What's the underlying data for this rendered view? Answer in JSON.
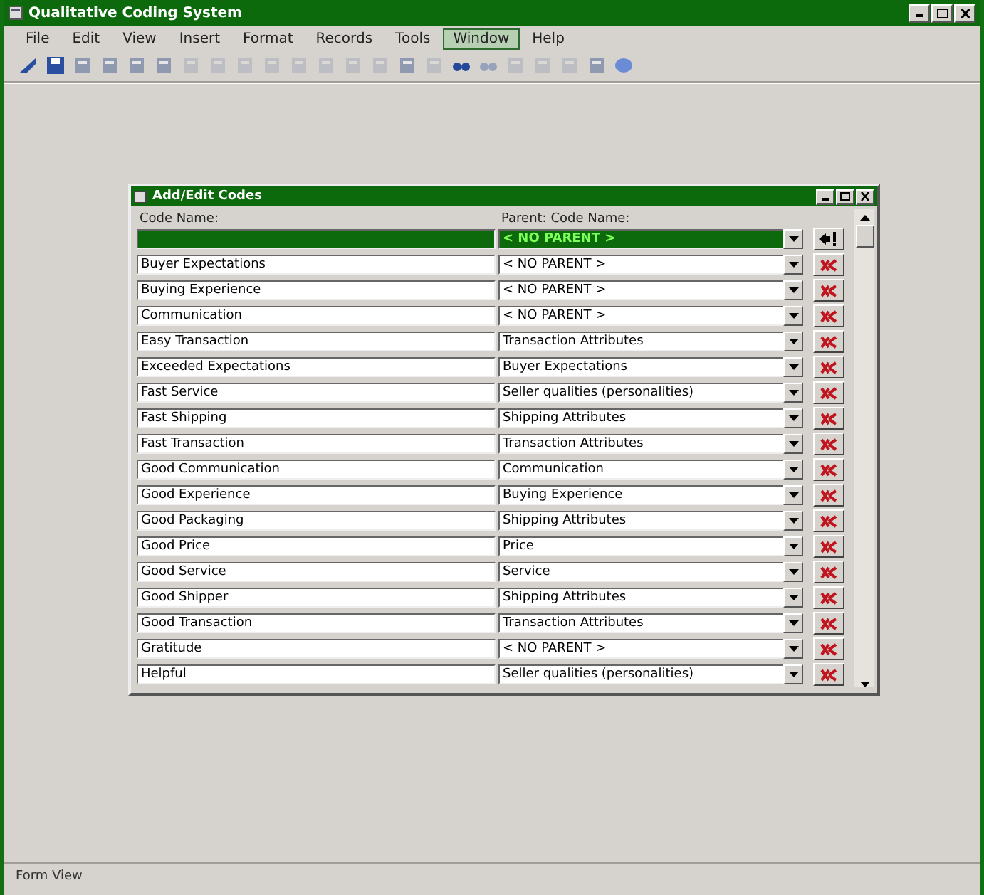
{
  "window": {
    "title": "Qualitative Coding System"
  },
  "menu": [
    {
      "label": "File",
      "selected": false
    },
    {
      "label": "Edit",
      "selected": false
    },
    {
      "label": "View",
      "selected": false
    },
    {
      "label": "Insert",
      "selected": false
    },
    {
      "label": "Format",
      "selected": false
    },
    {
      "label": "Records",
      "selected": false
    },
    {
      "label": "Tools",
      "selected": false
    },
    {
      "label": "Window",
      "selected": true
    },
    {
      "label": "Help",
      "selected": false
    }
  ],
  "form": {
    "title": "Add/Edit Codes",
    "columns": [
      "Code Name:",
      "Parent: Code Name:"
    ],
    "new_record": {
      "parent": "< NO PARENT >"
    },
    "rows": [
      {
        "code": "Buyer Expectations",
        "parent": "< NO PARENT >"
      },
      {
        "code": "Buying Experience",
        "parent": "< NO PARENT >"
      },
      {
        "code": "Communication",
        "parent": "< NO PARENT >"
      },
      {
        "code": "Easy Transaction",
        "parent": "Transaction Attributes"
      },
      {
        "code": "Exceeded Expectations",
        "parent": "Buyer Expectations"
      },
      {
        "code": "Fast Service",
        "parent": "Seller qualities (personalities)"
      },
      {
        "code": "Fast Shipping",
        "parent": "Shipping Attributes"
      },
      {
        "code": "Fast Transaction",
        "parent": "Transaction Attributes"
      },
      {
        "code": "Good Communication",
        "parent": "Communication"
      },
      {
        "code": "Good Experience",
        "parent": "Buying Experience"
      },
      {
        "code": "Good Packaging",
        "parent": "Shipping Attributes"
      },
      {
        "code": "Good Price",
        "parent": "Price"
      },
      {
        "code": "Good Service",
        "parent": "Service"
      },
      {
        "code": "Good Shipper",
        "parent": "Shipping Attributes"
      },
      {
        "code": "Good Transaction",
        "parent": "Transaction Attributes"
      },
      {
        "code": "Gratitude",
        "parent": "< NO PARENT >"
      },
      {
        "code": "Helpful",
        "parent": "Seller qualities (personalities)"
      }
    ]
  },
  "status_bar": {
    "text": "Form View"
  }
}
